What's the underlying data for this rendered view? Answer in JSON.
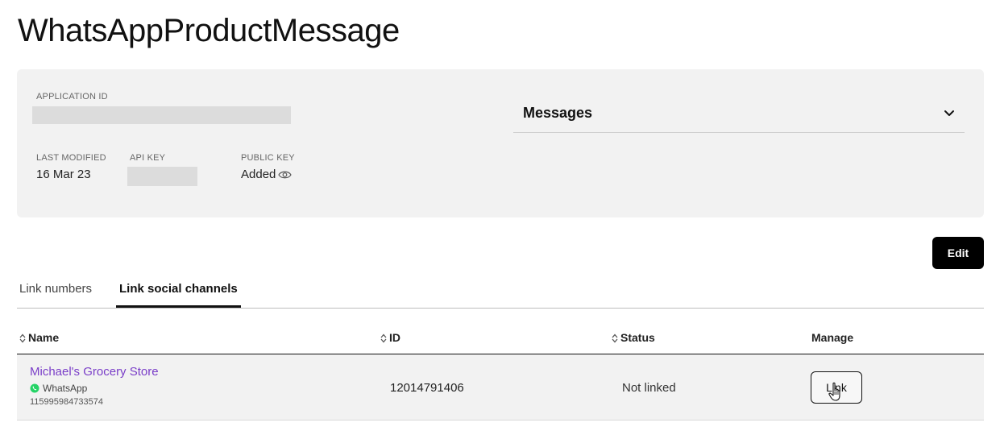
{
  "page": {
    "title": "WhatsAppProductMessage"
  },
  "info": {
    "application_id_label": "APPLICATION ID",
    "last_modified_label": "LAST MODIFIED",
    "last_modified_value": "16 Mar 23",
    "api_key_label": "API KEY",
    "public_key_label": "PUBLIC KEY",
    "public_key_value": "Added",
    "public_key_icon": "eye-icon"
  },
  "capabilities": {
    "messages_label": "Messages",
    "expand_icon": "chevron-down-icon"
  },
  "actions": {
    "edit_label": "Edit"
  },
  "tabs": [
    {
      "label": "Link numbers",
      "active": false
    },
    {
      "label": "Link social channels",
      "active": true
    }
  ],
  "table": {
    "headers": {
      "name": "Name",
      "id": "ID",
      "status": "Status",
      "manage": "Manage"
    },
    "rows": [
      {
        "name": "Michael's Grocery Store",
        "channel": "WhatsApp",
        "channel_icon": "whatsapp-icon",
        "channel_number": "115995984733574",
        "id": "12014791406",
        "status": "Not linked",
        "action_label": "Link"
      }
    ]
  },
  "colors": {
    "accent_link": "#7a3ec8",
    "whatsapp_green": "#25d366",
    "primary_button": "#000000",
    "card_background": "#f2f2f2"
  }
}
